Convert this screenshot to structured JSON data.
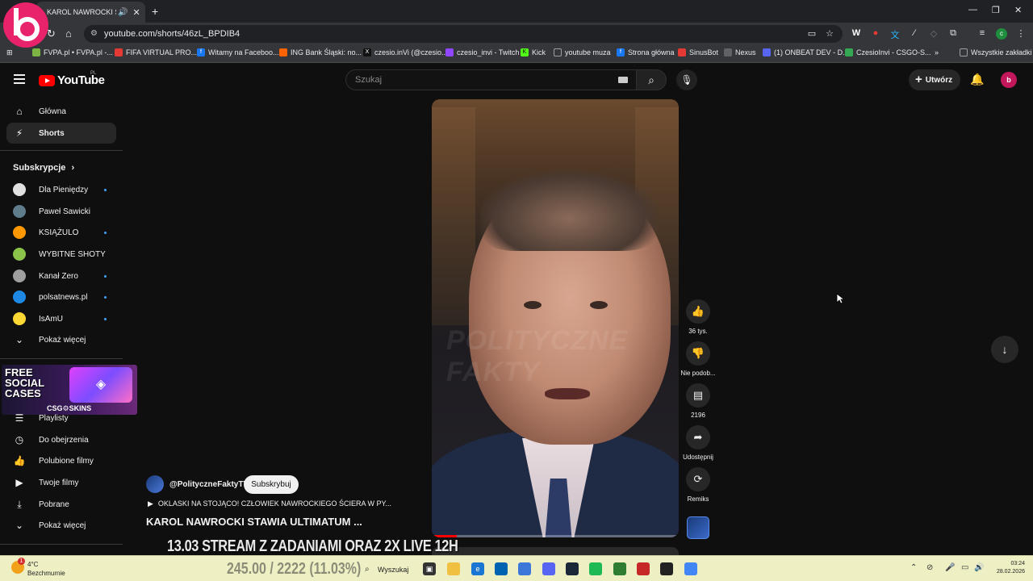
{
  "browser": {
    "tab_title": "KAROL NAWROCKI STAWIA",
    "url": "youtube.com/shorts/46zL_BPDIB4",
    "bookmarks": [
      {
        "label": "FVPA.pl • FVPA.pl -...",
        "color": "#7cb342"
      },
      {
        "label": "FIFA VIRTUAL PRO...",
        "color": "#e53935"
      },
      {
        "label": "Witamy na Faceboo...",
        "color": "#1877f2"
      },
      {
        "label": "ING Bank Śląski: no...",
        "color": "#ff6200"
      },
      {
        "label": "czesio.inVi (@czesio...",
        "color": "#000000"
      },
      {
        "label": "czesio_invi - Twitch",
        "color": "#9146ff"
      },
      {
        "label": "Kick",
        "color": "#53fc18"
      },
      {
        "label": "youtube muza",
        "color": "#9aa0a6"
      },
      {
        "label": "Strona główna",
        "color": "#1877f2"
      },
      {
        "label": "SinusBot",
        "color": "#e53935"
      },
      {
        "label": "Nexus",
        "color": "#9aa0a6"
      },
      {
        "label": "(1) ONBEAT DEV - D...",
        "color": "#5865f2"
      },
      {
        "label": "CzesioInvi - CSGO-S...",
        "color": "#34a853"
      }
    ],
    "all_bookmarks": "Wszystkie zakładki"
  },
  "header": {
    "logo_text": "YouTube",
    "country": "PL",
    "search_placeholder": "Szukaj",
    "create_label": "Utwórz",
    "avatar_letter": "b"
  },
  "sidebar": {
    "main": [
      {
        "label": "Główna",
        "icon": "home-icon"
      },
      {
        "label": "Shorts",
        "icon": "shorts-icon"
      }
    ],
    "subs_heading": "Subskrypcje",
    "subs": [
      {
        "label": "Dla Pieniędzy",
        "color": "#e0e0e0",
        "new": true
      },
      {
        "label": "Paweł Sawicki",
        "color": "#607d8b",
        "new": false
      },
      {
        "label": "KSIĄŻULO",
        "color": "#ff9800",
        "new": true
      },
      {
        "label": "WYBITNE SHOTY",
        "color": "#8bc34a",
        "new": false
      },
      {
        "label": "Kanał Zero",
        "color": "#9e9e9e",
        "new": true
      },
      {
        "label": "polsatnews.pl",
        "color": "#1e88e5",
        "new": true
      },
      {
        "label": "IsAmU",
        "color": "#fdd835",
        "new": true
      }
    ],
    "show_more": "Pokaż więcej",
    "you": [
      {
        "label": "Playlisty",
        "icon": "playlist-icon"
      },
      {
        "label": "Do obejrzenia",
        "icon": "clock-icon"
      },
      {
        "label": "Polubione filmy",
        "icon": "thumbs-up-icon"
      },
      {
        "label": "Twoje filmy",
        "icon": "video-icon"
      },
      {
        "label": "Pobrane",
        "icon": "download-icon"
      },
      {
        "label": "Pokaż więcej",
        "icon": "chevron-down-icon"
      }
    ],
    "ad": {
      "headline": "FREE SOCIAL CASES",
      "brand": "CSG⚙SKINS"
    }
  },
  "short": {
    "watermark": "POLITYCZNE FAKTY",
    "progress_fraction": 0.1,
    "channel": "@PolityczneFaktyTV",
    "subscribe": "Subskrybuj",
    "playlist_line": "OKLASKI NA STOJĄCO! CZŁOWIEK NAWROCKIEGO ŚCIERA W PY...",
    "title": "KAROL NAWROCKI STAWIA ULTIMATUM ..."
  },
  "actions": {
    "likes": "36 tys.",
    "dislike": "Nie podob...",
    "comments": "2196",
    "share": "Udostępnij",
    "remix": "Remiks"
  },
  "stream_overlay": "13.03 STREAM Z ZADANIAMI ORAZ 2X LIVE 12H",
  "counter_overlay": "245.00 / 2222 (11.03%)",
  "taskbar": {
    "temperature": "4°C",
    "weather": "Bezchmurnie",
    "badge": "1",
    "search": "Wyszukaj",
    "time": "03:24",
    "date": "28.02.2026"
  }
}
